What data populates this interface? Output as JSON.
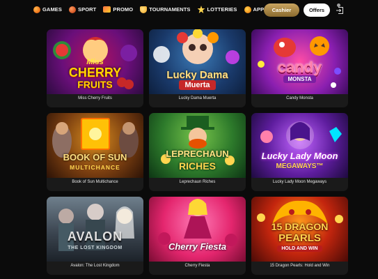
{
  "nav": {
    "items": [
      {
        "label": "GAMES",
        "icon": "games-icon"
      },
      {
        "label": "SPORT",
        "icon": "sport-ball-icon"
      },
      {
        "label": "PROMO",
        "icon": "promo-ticket-icon"
      },
      {
        "label": "TOURNAMENTS",
        "icon": "trophy-icon"
      },
      {
        "label": "LOTTERIES",
        "icon": "star-icon"
      },
      {
        "label": "APPLICATION",
        "icon": "app-icon"
      }
    ],
    "cashier_label": "Cashier",
    "offers_label": "Offers",
    "logout_icon": "logout-icon"
  },
  "colors": {
    "background": "#0b0b0b",
    "card": "#1a1a1a",
    "cashier_gold": "#c9a561",
    "offers_white": "#ffffff"
  },
  "games": [
    {
      "title": "Miss Cherry Fruits",
      "art_text": [
        "Miss",
        "CHERRY",
        "FRUITS"
      ]
    },
    {
      "title": "Lucky Dama Muerta",
      "art_text": [
        "Lucky Dama",
        "Muerta"
      ]
    },
    {
      "title": "Candy Monsta",
      "art_text": [
        "candy",
        "MONSTA"
      ]
    },
    {
      "title": "Book of Sun Multichance",
      "art_text": [
        "BOOK OF SUN",
        "MULTICHANCE"
      ]
    },
    {
      "title": "Leprechaun Riches",
      "art_text": [
        "LEPRECHAUN",
        "RICHES"
      ]
    },
    {
      "title": "Lucky Lady Moon Megaways",
      "art_text": [
        "Lucky Lady Moon",
        "MEGAWAYS™"
      ]
    },
    {
      "title": "Avalon: The Lost Kingdom",
      "art_text": [
        "AVALON",
        "THE LOST KINGDOM"
      ]
    },
    {
      "title": "Cherry Fiesta",
      "art_text": [
        "Cherry Fiesta"
      ]
    },
    {
      "title": "15 Dragon Pearls: Hold and Win",
      "art_text": [
        "15 DRAGON",
        "PEARLS",
        "HOLD AND WIN"
      ]
    }
  ]
}
